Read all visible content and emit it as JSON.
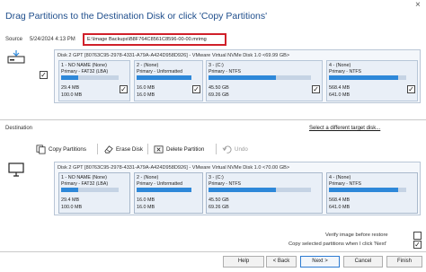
{
  "dialog": {
    "title": "Drag Partitions to the Destination Disk or click 'Copy Partitions'",
    "close_glyph": "×"
  },
  "source": {
    "label": "Source",
    "date": "5/24/2024 4:13 PM",
    "path": "E:\\Image Backups\\B8F764C8561C8596-00-00.mrimg",
    "checked": true,
    "disk": {
      "header": "Disk 2 GPT [80763C95-2978-4331-A79A-A424D958D926] - VMware Virtual NVMe Disk 1.0 <69.99 GB>",
      "partitions": [
        {
          "name": "1 - NO NAME (None)",
          "type": "Primary - FAT32 (LBA)",
          "used": "29.4 MB",
          "total": "100.0 MB",
          "fill": 0.29,
          "checked": true
        },
        {
          "name": "2 - (None)",
          "type": "Primary - Unformatted",
          "used": "16.0 MB",
          "total": "16.0 MB",
          "fill": 1.0,
          "checked": true
        },
        {
          "name": "3 - (C:)",
          "type": "Primary - NTFS",
          "used": "45.50 GB",
          "total": "69.26 GB",
          "fill": 0.66,
          "checked": true
        },
        {
          "name": "4 - (None)",
          "type": "Primary - NTFS",
          "used": "568.4 MB",
          "total": "641.0 MB",
          "fill": 0.89,
          "checked": true
        }
      ]
    }
  },
  "destination": {
    "label": "Destination",
    "select_link": "Select a different target disk...",
    "toolbar": {
      "copy_partitions": "Copy Partitions",
      "erase_disk": "Erase Disk",
      "delete_partition": "Delete Partition",
      "undo": "Undo"
    },
    "disk": {
      "header": "Disk 2 GPT [80763C95-2978-4331-A79A-A424D958D926] - VMware Virtual NVMe Disk 1.0 <70.00 GB>",
      "partitions": [
        {
          "name": "1 - NO NAME (None)",
          "type": "Primary - FAT32 (LBA)",
          "used": "29.4 MB",
          "total": "100.0 MB",
          "fill": 0.29
        },
        {
          "name": "2 - (None)",
          "type": "Primary - Unformatted",
          "used": "16.0 MB",
          "total": "16.0 MB",
          "fill": 1.0
        },
        {
          "name": "3 - (C:)",
          "type": "Primary - NTFS",
          "used": "45.50 GB",
          "total": "69.26 GB",
          "fill": 0.66
        },
        {
          "name": "4 - (None)",
          "type": "Primary - NTFS",
          "used": "568.4 MB",
          "total": "641.0 MB",
          "fill": 0.89
        }
      ]
    }
  },
  "options": {
    "verify_label": "Verify image before restore",
    "verify_checked": false,
    "copy_selected_label": "Copy selected partitions when I click 'Next'",
    "copy_selected_checked": true
  },
  "buttons": {
    "help": "Help",
    "back": "< Back",
    "next": "Next >",
    "cancel": "Cancel",
    "finish": "Finish"
  },
  "colors": {
    "title": "#1f4e8c",
    "highlight_box": "#d0202a",
    "bar_fill": "#2e88d9"
  }
}
